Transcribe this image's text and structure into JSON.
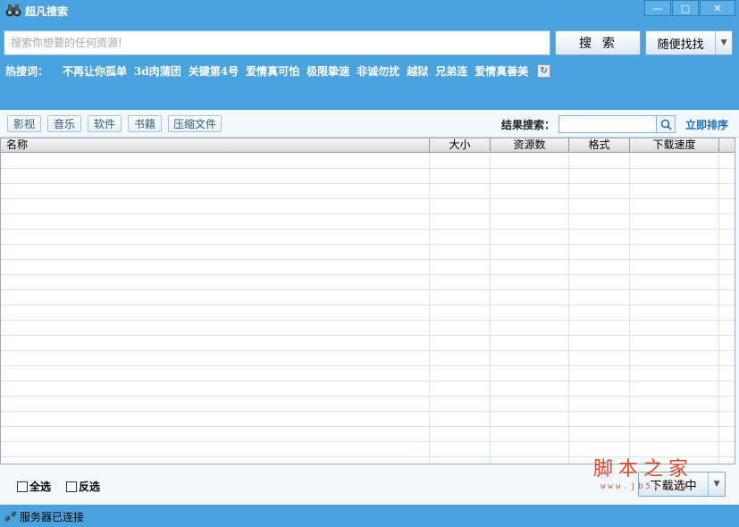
{
  "window": {
    "title": "超凡搜索",
    "icon": "binoculars-icon",
    "controls": [
      "minimize",
      "maximize",
      "close"
    ]
  },
  "search": {
    "placeholder": "搜索你想要的任何资源!",
    "button_label": "搜索",
    "random_label": "随便找找"
  },
  "hot": {
    "label": "热搜词：",
    "words": [
      "不再让你孤单",
      "3d肉蒲团",
      "关键第4号",
      "爱情真可怕",
      "极限挚速",
      "非诚勿扰",
      "越狱",
      "兄弟连",
      "爱情真善美"
    ]
  },
  "categories": [
    "影视",
    "音乐",
    "软件",
    "书籍",
    "压缩文件"
  ],
  "result_search": {
    "label": "结果搜索：",
    "value": "",
    "sort_label": "立即排序"
  },
  "table": {
    "columns": [
      "名称",
      "大小",
      "资源数",
      "格式",
      "下载速度"
    ],
    "rows": []
  },
  "bottom": {
    "select_all": "全选",
    "invert": "反选",
    "download_label": "下载选中"
  },
  "watermark": {
    "text": "脚本之家",
    "sub": "www.jb51.net"
  },
  "status": {
    "text": "服务器已连接"
  },
  "colors": {
    "accent": "#4aa3df",
    "link": "#1a6fbf",
    "watermark": "#d94b2b"
  }
}
